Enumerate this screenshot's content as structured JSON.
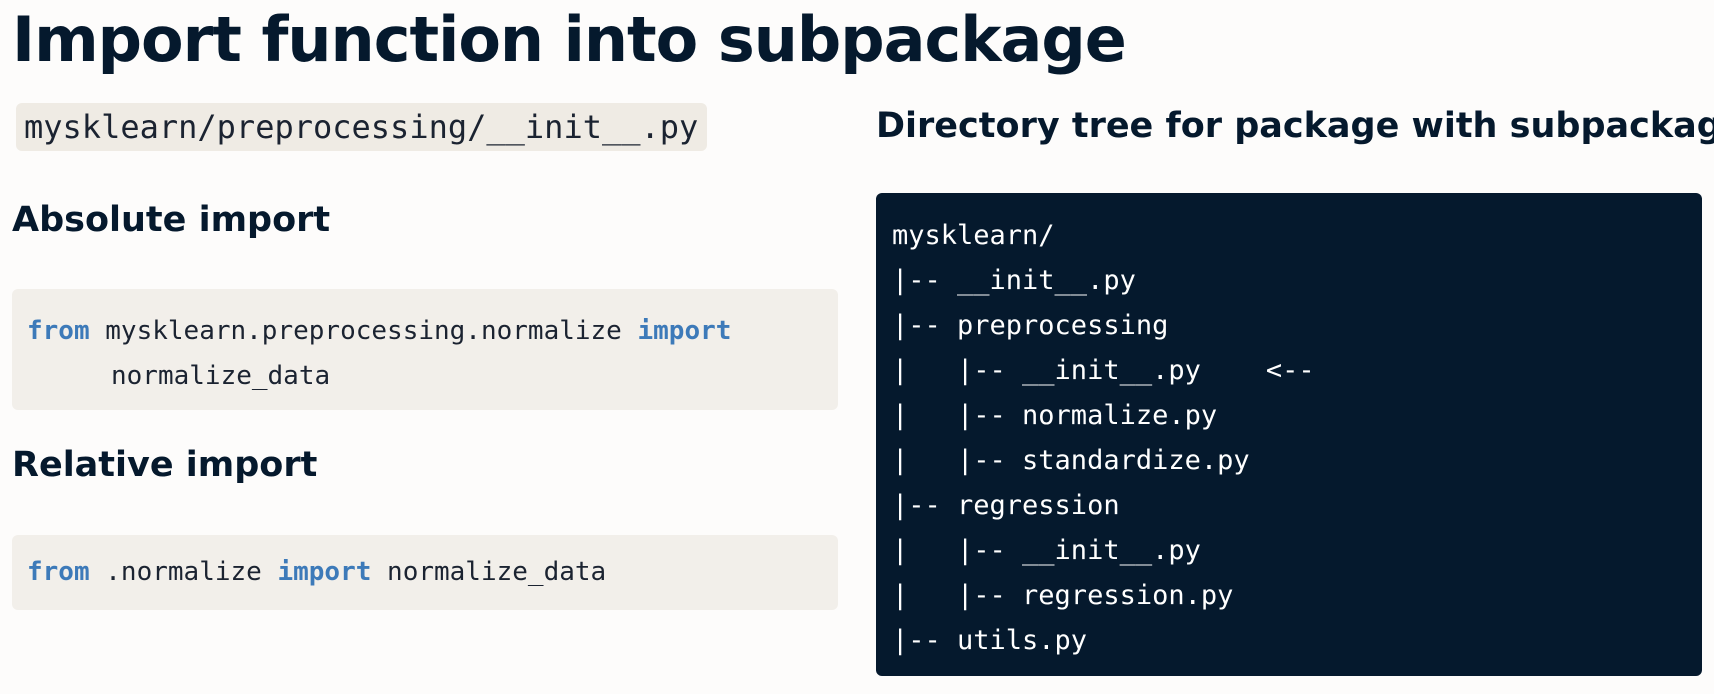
{
  "title": "Import function into subpackage",
  "file_path": "mysklearn/preprocessing/__init__.py",
  "absolute_section": {
    "label": "Absolute import",
    "kw_from": "from",
    "module": " mysklearn.preprocessing.normalize ",
    "kw_import": "import",
    "name": "normalize_data"
  },
  "relative_section": {
    "label": "Relative import",
    "kw_from": "from",
    "module": " .normalize ",
    "kw_import": "import",
    "name": " normalize_data"
  },
  "tree": {
    "heading": "Directory tree for package with subpackages",
    "lines": [
      "mysklearn/",
      "|-- __init__.py",
      "|-- preprocessing",
      "|   |-- __init__.py    <--",
      "|   |-- normalize.py",
      "|   |-- standardize.py",
      "|-- regression",
      "|   |-- __init__.py",
      "|   |-- regression.py",
      "|-- utils.py"
    ]
  },
  "colors": {
    "background": "#fdfcfb",
    "text": "#05192d",
    "code_background": "#f2efea",
    "keyword": "#3d7ab9",
    "tree_background": "#05192d",
    "tree_text": "#ffffff"
  }
}
